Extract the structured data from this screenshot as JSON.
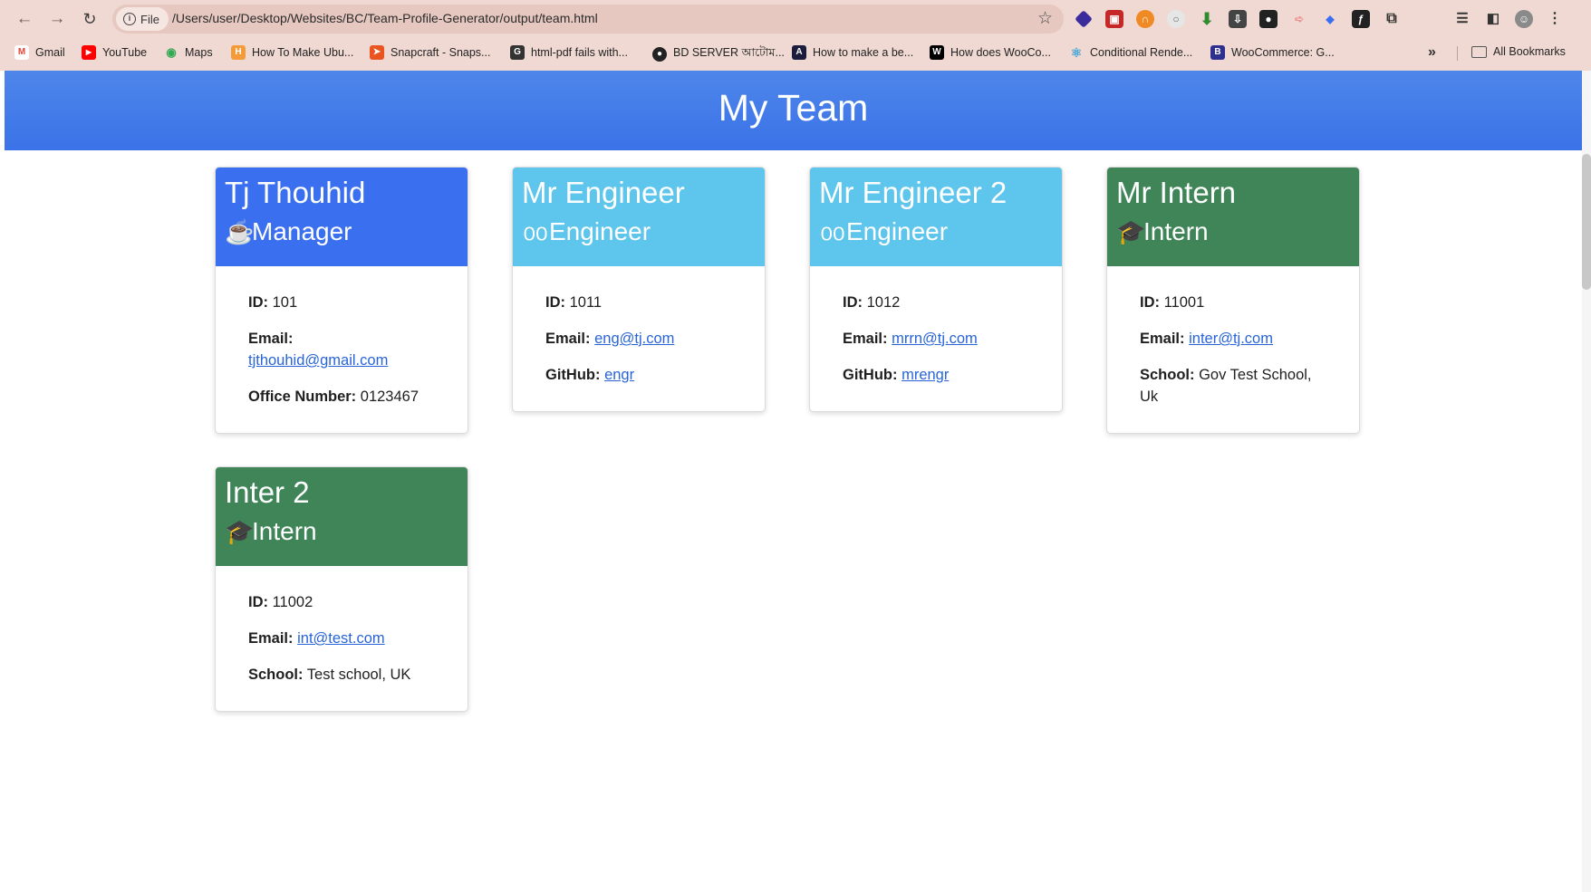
{
  "browser": {
    "file_chip": "File",
    "url": "/Users/user/Desktop/Websites/BC/Team-Profile-Generator/output/team.html",
    "bookmarks": [
      {
        "label": "Gmail",
        "color": "#ea4335",
        "glyph": "M"
      },
      {
        "label": "YouTube",
        "color": "#ff0000",
        "glyph": "▶"
      },
      {
        "label": "Maps",
        "color": "#34a853",
        "glyph": "◉"
      },
      {
        "label": "How To Make Ubu...",
        "color": "#f29b38",
        "glyph": "H"
      },
      {
        "label": "Snapcraft - Snaps...",
        "color": "#e95420",
        "glyph": "➤"
      },
      {
        "label": "html-pdf fails with...",
        "color": "#333333",
        "glyph": "G"
      },
      {
        "label": "BD SERVER আটোম...",
        "color": "#222222",
        "glyph": "●"
      },
      {
        "label": "How to make a be...",
        "color": "#1c1c3c",
        "glyph": "A"
      },
      {
        "label": "How does WooCo...",
        "color": "#000000",
        "glyph": "W"
      },
      {
        "label": "Conditional Rende...",
        "color": "#61dafb",
        "glyph": "⚛"
      },
      {
        "label": "WooCommerce: G...",
        "color": "#2f2f8f",
        "glyph": "B"
      }
    ],
    "all_bookmarks": "All Bookmarks"
  },
  "header": {
    "title": "My Team"
  },
  "cards": [
    {
      "name": "Tj Thouhid",
      "role": "Manager",
      "icon": "coffee-icon",
      "color": "#3a6ff0",
      "id_label": "ID:",
      "id": "101",
      "email_label": "Email:",
      "email": "tjthouhid@gmail.com",
      "extra_label": "Office Number:",
      "extra": "0123467"
    },
    {
      "name": "Mr Engineer",
      "role": "Engineer",
      "icon": "glasses-icon",
      "color": "#5ec5ec",
      "id_label": "ID:",
      "id": "1011",
      "email_label": "Email:",
      "email": "eng@tj.com",
      "extra_label": "GitHub:",
      "extra": "engr"
    },
    {
      "name": "Mr Engineer 2",
      "role": "Engineer",
      "icon": "glasses-icon",
      "color": "#5ec5ec",
      "id_label": "ID:",
      "id": "1012",
      "email_label": "Email:",
      "email": "mrrn@tj.com",
      "extra_label": "GitHub:",
      "extra": "mrengr"
    },
    {
      "name": "Mr Intern",
      "role": "Intern",
      "icon": "graduate-icon",
      "color": "#3f8558",
      "id_label": "ID:",
      "id": "11001",
      "email_label": "Email:",
      "email": "inter@tj.com",
      "extra_label": "School:",
      "extra": "Gov Test School, Uk"
    },
    {
      "name": "Inter 2",
      "role": "Intern",
      "icon": "graduate-icon",
      "color": "#3f8558",
      "id_label": "ID:",
      "id": "11002",
      "email_label": "Email:",
      "email": "int@test.com",
      "extra_label": "School:",
      "extra": "Test school, UK"
    }
  ]
}
